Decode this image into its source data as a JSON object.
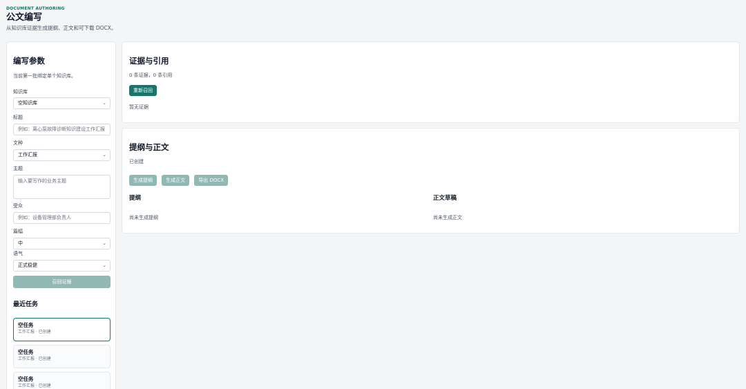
{
  "header": {
    "eyebrow": "DOCUMENT AUTHORING",
    "title": "公文编写",
    "subtitle": "从知识库证据生成提纲、正文和可下载 DOCX。"
  },
  "params": {
    "title": "编写参数",
    "note": "当前第一批绑定单个知识库。",
    "kb_label": "知识库",
    "kb_value": "空知识库",
    "title_label": "标题",
    "title_placeholder": "例如：离心泵故障诊断知识建设工作汇报",
    "doctype_label": "文种",
    "doctype_value": "工作汇报",
    "topic_label": "主题",
    "topic_placeholder": "输入要写作的业务主题",
    "audience_label": "受众",
    "audience_placeholder": "例如：设备管理部负责人",
    "length_label": "篇幅",
    "length_value": "中",
    "tone_label": "语气",
    "tone_value": "正式稳健",
    "recall_button": "召回证据"
  },
  "tasks": {
    "title": "最近任务",
    "items": [
      {
        "name": "空任务",
        "meta": "工作汇报 · 已创建"
      },
      {
        "name": "空任务",
        "meta": "工作汇报 · 已创建"
      },
      {
        "name": "空任务",
        "meta": "工作汇报 · 已创建"
      }
    ]
  },
  "evidence": {
    "title": "证据与引用",
    "stats": "0 条证据，0 条引用",
    "rerecall_button": "重新召回",
    "empty": "暂无证据"
  },
  "outline": {
    "title": "提纲与正文",
    "status": "已创建",
    "gen_outline_button": "生成提纲",
    "gen_body_button": "生成正文",
    "export_button": "导出 DOCX",
    "outline_head": "提纲",
    "outline_empty": "尚未生成提纲",
    "body_head": "正文草稿",
    "body_empty": "尚未生成正文"
  },
  "colors": {
    "accent": "#0f7a6e",
    "primary_button": "#17766b",
    "disabled_button": "#8fb9b2",
    "background": "#f3f5f7"
  },
  "icons": {
    "select_arrow": "chevron-down-icon"
  }
}
